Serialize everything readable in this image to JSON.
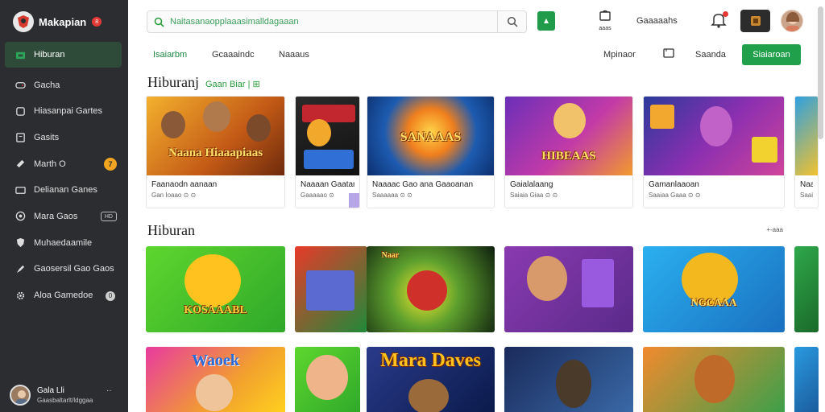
{
  "brand": {
    "name": "Makapian",
    "badge": "8"
  },
  "sidebar": {
    "items": [
      {
        "label": "Hiburan",
        "icon": "store-icon"
      },
      {
        "label": "Gacha",
        "icon": "gamepad-icon"
      },
      {
        "label": "Hiasanpai Gartes",
        "icon": "square-icon"
      },
      {
        "label": "Gasits",
        "icon": "clipboard-icon"
      },
      {
        "label": "Marth O",
        "icon": "tag-icon",
        "badge": "7"
      },
      {
        "label": "Delianan Ganes",
        "icon": "card-icon"
      },
      {
        "label": "Mara Gaos",
        "icon": "globe-icon",
        "pill": "HD"
      },
      {
        "label": "Muhaedaamile",
        "icon": "shield-icon"
      },
      {
        "label": "Gaosersil Gao Gaos",
        "icon": "rocket-icon"
      },
      {
        "label": "Aloa Gamedoe",
        "icon": "gear-icon",
        "dot": "0"
      }
    ]
  },
  "profile": {
    "name": "Gala Lli",
    "sub": "Gaasbaltarlt/ldggaa",
    "menu": "··"
  },
  "topbar": {
    "search_placeholder": "Naitasanaopplaaasimalldagaaan",
    "store_label": "aaas",
    "link": "Gaaaaahs"
  },
  "subnav": {
    "tabs": [
      "Isaiarbm",
      "Gcaaaindc",
      "Naaaus"
    ],
    "right_link": "Mpinaor",
    "right_link2": "Saanda",
    "cta": "Siaiaroan"
  },
  "section1": {
    "title": "Hiburanj",
    "tag": "Gaan Biar | ⊞",
    "cards": [
      {
        "title": "Faanaodn aanaan",
        "sub": "Gan Ioaao ⊙ ⊙",
        "caption": "Naana Hiaaapiaas"
      },
      {
        "title": "Naaaan Gaatan",
        "sub": "Gaaaaao ⊙",
        "caption": ""
      },
      {
        "title": "Naaaac Gao ana Gaaoanan",
        "sub": "Saaaaaa ⊙ ⊙",
        "caption": "SANAAAS"
      },
      {
        "title": "Gaialalaang",
        "sub": "Saiaia Giaa ⊙ ⊙",
        "caption": "HIBEAAS"
      },
      {
        "title": "Gamanlaaoan",
        "sub": "Saaiaa Gaaa ⊙ ⊙",
        "caption": ""
      },
      {
        "title": "Naa",
        "sub": "Saai",
        "caption": ""
      }
    ]
  },
  "section2": {
    "title": "Hiburan",
    "see_all": "+-aaa",
    "row1_captions": [
      "KOSAAABL",
      "",
      "Naar",
      "",
      "NGCAAA",
      ""
    ],
    "row2_captions": [
      "Waoek",
      "",
      "Mara Daves",
      "",
      "",
      ""
    ]
  }
}
